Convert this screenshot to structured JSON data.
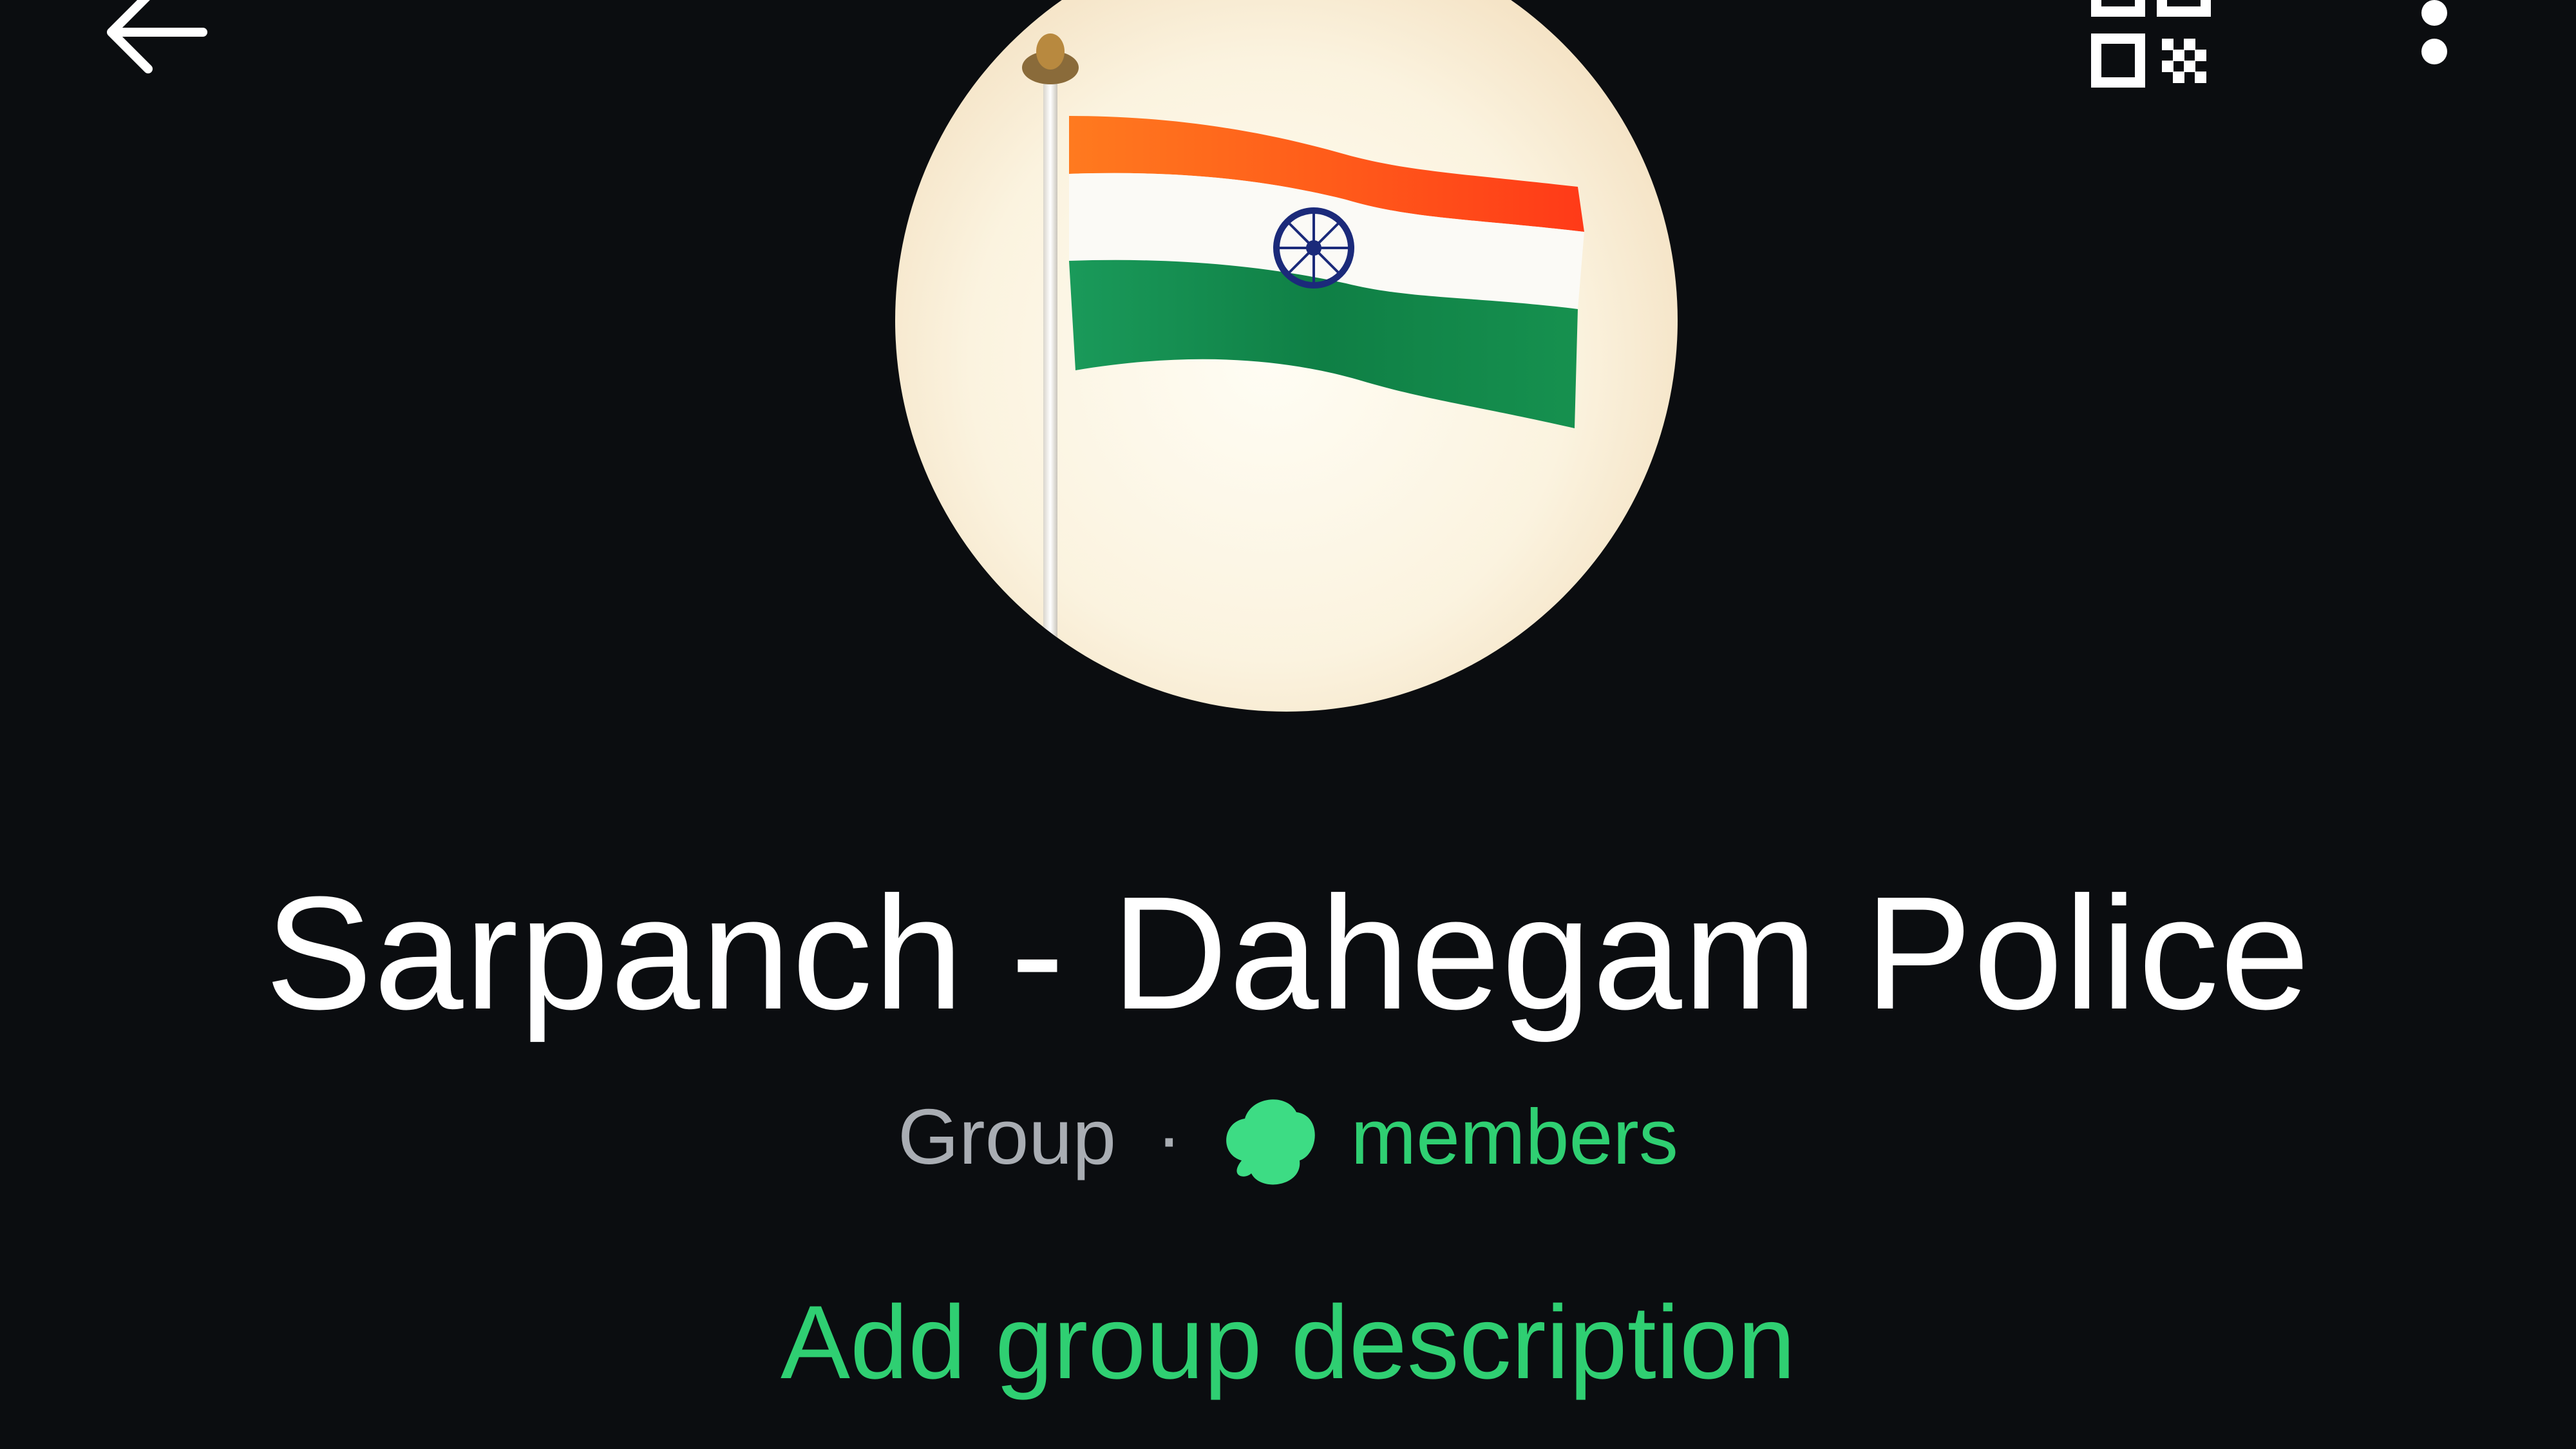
{
  "header": {
    "back_icon": "arrow-left-icon",
    "qr_icon": "qr-code-icon",
    "menu_icon": "more-vertical-icon"
  },
  "profile": {
    "avatar_subject": "indian-flag-photo",
    "group_name": "Sarpanch - Dahegam Police",
    "type_label": "Group",
    "separator": "·",
    "member_count": "",
    "members_label": "members",
    "add_description_label": "Add group description"
  },
  "colors": {
    "background": "#0b0d10",
    "accent_green": "#2fcf72",
    "primary_text": "#ffffff",
    "secondary_text": "#a9adb3"
  }
}
